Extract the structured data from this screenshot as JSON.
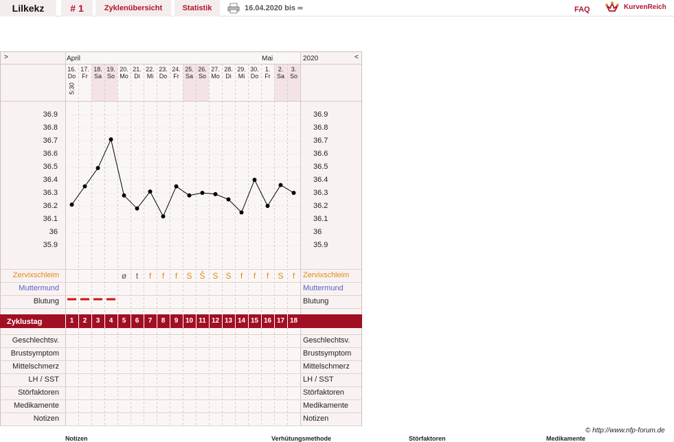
{
  "topbar": {
    "user": "Lilkekz",
    "cycle": "# 1",
    "overview": "Zyklenübersicht",
    "statistics": "Statistik",
    "range": "16.04.2020 bis ∞",
    "faq": "FAQ",
    "brand": "KurvenReich"
  },
  "header": {
    "left_arrow": ">",
    "right_arrow": "<",
    "month_start": "April",
    "month_mid": "Mai",
    "year": "2020",
    "first_time": "5:30"
  },
  "days": [
    {
      "date": "16.",
      "wd": "Do",
      "weekend": false
    },
    {
      "date": "17.",
      "wd": "Fr",
      "weekend": false
    },
    {
      "date": "18.",
      "wd": "Sa",
      "weekend": true
    },
    {
      "date": "19.",
      "wd": "So",
      "weekend": true
    },
    {
      "date": "20.",
      "wd": "Mo",
      "weekend": false
    },
    {
      "date": "21.",
      "wd": "Di",
      "weekend": false
    },
    {
      "date": "22.",
      "wd": "Mi",
      "weekend": false
    },
    {
      "date": "23.",
      "wd": "Do",
      "weekend": false
    },
    {
      "date": "24.",
      "wd": "Fr",
      "weekend": false
    },
    {
      "date": "25.",
      "wd": "Sa",
      "weekend": true
    },
    {
      "date": "26.",
      "wd": "So",
      "weekend": true
    },
    {
      "date": "27.",
      "wd": "Mo",
      "weekend": false
    },
    {
      "date": "28.",
      "wd": "Di",
      "weekend": false
    },
    {
      "date": "29.",
      "wd": "Mi",
      "weekend": false
    },
    {
      "date": "30.",
      "wd": "Do",
      "weekend": false
    },
    {
      "date": "1.",
      "wd": "Fr",
      "weekend": false
    },
    {
      "date": "2.",
      "wd": "Sa",
      "weekend": true
    },
    {
      "date": "3.",
      "wd": "So",
      "weekend": true
    }
  ],
  "chart_data": {
    "type": "line",
    "ylim": [
      35.9,
      36.9
    ],
    "y_ticks": [
      "36.9",
      "36.8",
      "36.7",
      "36.6",
      "36.5",
      "36.4",
      "36.3",
      "36.2",
      "36.1",
      "36",
      "35.9"
    ],
    "cycle_days": [
      1,
      2,
      3,
      4,
      5,
      6,
      7,
      8,
      9,
      10,
      11,
      12,
      13,
      14,
      15,
      16,
      17,
      18
    ],
    "temperatures": [
      36.21,
      36.35,
      36.49,
      36.71,
      36.28,
      36.18,
      36.31,
      36.12,
      36.35,
      36.28,
      36.3,
      36.29,
      36.25,
      36.15,
      36.4,
      36.2,
      36.36,
      36.3
    ]
  },
  "rows": {
    "zervix": "Zervixschleim",
    "muttermund": "Muttermund",
    "blutung": "Blutung",
    "zyklustag": "Zyklustag",
    "geschlecht": "Geschlechtsv.",
    "brust": "Brustsymptom",
    "mittel": "Mittelschmerz",
    "lh": "LH / SST",
    "stoer": "Störfaktoren",
    "medi": "Medikamente",
    "notizen": "Notizen"
  },
  "zervix_symbols": [
    "",
    "",
    "",
    "",
    "ø",
    "t",
    "f",
    "f",
    "f",
    "S",
    "S̊",
    "S",
    "S",
    "f",
    "f",
    "f",
    "S",
    "f",
    "f"
  ],
  "bleeding_days": [
    1,
    2,
    3,
    4
  ],
  "colors": {
    "accent": "#b0132a",
    "zervix": "#e0881a",
    "mutter": "#5560c8",
    "grid": "#d9c9c9",
    "weekend": "#f3e3e6",
    "panel": "#f9f2f2"
  },
  "footer": {
    "url": "© http://www.nfp-forum.de",
    "col1": "Notizen",
    "col2": "Verhütungsmethode",
    "col3": "Störfaktoren",
    "col4": "Medikamente"
  }
}
